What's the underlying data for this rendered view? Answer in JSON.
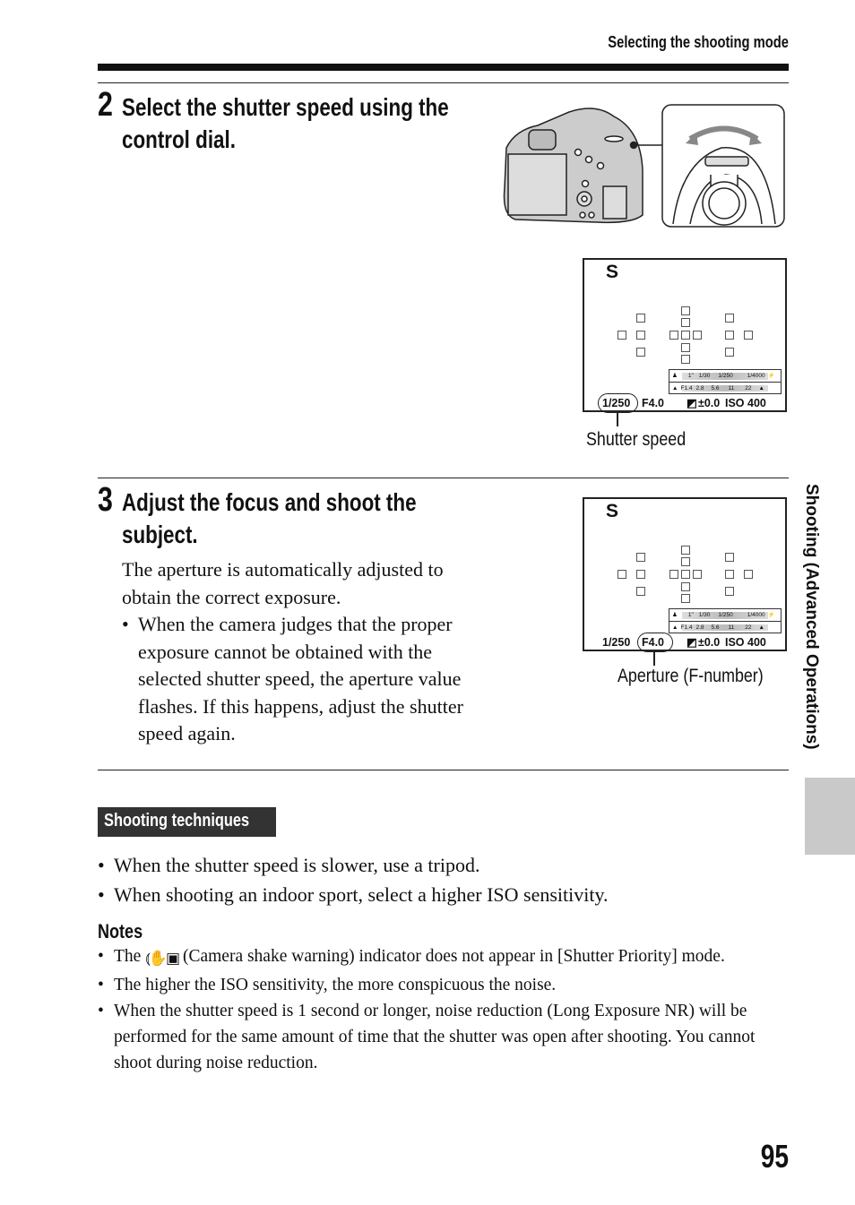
{
  "running_head": "Selecting the shooting mode",
  "step2": {
    "number": "2",
    "title_lines": [
      "Select the shutter speed using the",
      "control dial."
    ],
    "viewfinder": {
      "mode": "S",
      "shutter": "1/250",
      "aperture": "F4.0",
      "exposure_comp": "±0.0",
      "iso": "ISO 400",
      "scale_top": [
        "1\"",
        "1/30",
        "1/250",
        "1/4000"
      ],
      "scale_bottom": [
        "F1.4",
        "2.8",
        "5.6",
        "11",
        "22"
      ],
      "highlight": "shutter"
    },
    "caption": "Shutter speed"
  },
  "step3": {
    "number": "3",
    "title_lines": [
      "Adjust the focus and shoot the",
      "subject."
    ],
    "body": "The aperture is automatically adjusted to obtain the correct exposure.",
    "bullets": [
      "When the camera judges that the proper exposure cannot be obtained with the selected shutter speed, the aperture value flashes. If this happens, adjust the shutter speed again."
    ],
    "viewfinder": {
      "mode": "S",
      "shutter": "1/250",
      "aperture": "F4.0",
      "exposure_comp": "±0.0",
      "iso": "ISO 400",
      "scale_top": [
        "1\"",
        "1/30",
        "1/250",
        "1/4000"
      ],
      "scale_bottom": [
        "F1.4",
        "2.8",
        "5.6",
        "11",
        "22"
      ],
      "highlight": "aperture"
    },
    "caption": "Aperture (F-number)"
  },
  "side_tab": "Shooting (Advanced Operations)",
  "techniques": {
    "label": "Shooting techniques",
    "bullets": [
      "When the shutter speed is slower, use a tripod.",
      "When shooting an indoor sport, select a higher ISO sensitivity."
    ]
  },
  "notes": {
    "heading": "Notes",
    "items": [
      {
        "prefix": "The",
        "icon": "camera-shake-warning-icon",
        "text": "(Camera shake warning) indicator does not appear in [Shutter Priority] mode."
      },
      {
        "text": "The higher the ISO sensitivity, the more conspicuous the noise."
      },
      {
        "text": "When the shutter speed is 1 second or longer, noise reduction (Long Exposure NR) will be performed for the same amount of time that the shutter was open after shooting. You cannot shoot during noise reduction."
      }
    ]
  },
  "page_number": "95"
}
